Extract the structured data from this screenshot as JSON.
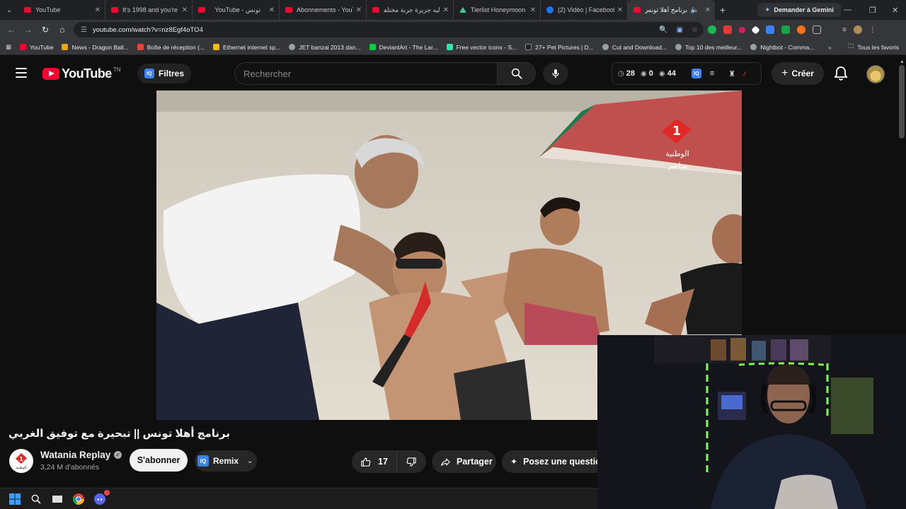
{
  "browser": {
    "tabs": [
      {
        "title": "YouTube",
        "icon": "youtube-favicon",
        "active": false
      },
      {
        "title": "It's 1998 and you're o",
        "icon": "youtube-favicon",
        "active": false
      },
      {
        "title": "YouTube - تونس",
        "icon": "youtube-favicon",
        "active": false
      },
      {
        "title": "Abonnements - YouT",
        "icon": "youtube-favicon",
        "active": false
      },
      {
        "title": "ليه جزيرة جربة مختلفة",
        "icon": "youtube-favicon",
        "active": false
      },
      {
        "title": "Tierlist Honeymoon d",
        "icon": "tierlist-favicon",
        "active": false
      },
      {
        "title": "(2) Vidéo | Facebook",
        "icon": "facebook-favicon",
        "active": false
      },
      {
        "title": "برنامج أهلا تونس ||",
        "icon": "youtube-favicon",
        "active": true
      }
    ],
    "gemini_label": "Demander à Gemini",
    "url": "youtube.com/watch?v=nz8Egf4oTO4",
    "bookmarks": [
      {
        "label": "YouTube",
        "color": "#ff0033"
      },
      {
        "label": "News - Dragon Ball...",
        "color": "#f4a300"
      },
      {
        "label": "Boîte de réception (...",
        "color": "#ea4335"
      },
      {
        "label": "Ethernet internet sp...",
        "color": "#fbbc04"
      },
      {
        "label": "JET banzai 2013 dan...",
        "color": "#9aa0a6"
      },
      {
        "label": "DeviantArt - The Lar...",
        "color": "#05cc47"
      },
      {
        "label": "Free vector icons - S...",
        "color": "#2ee6a8"
      },
      {
        "label": "27+ Pet Pictures | D...",
        "color": "#202124"
      },
      {
        "label": "Cut and Download...",
        "color": "#9aa0a6"
      },
      {
        "label": "Top 10 des meilleur...",
        "color": "#9aa0a6"
      },
      {
        "label": "Nightbot - Comma...",
        "color": "#9aa0a6"
      }
    ],
    "all_bookmarks_label": "Tous les favoris"
  },
  "youtube": {
    "logo_text": "YouTube",
    "country_code": "TN",
    "filtres_label": "Filtres",
    "search_placeholder": "Rechercher",
    "stats": {
      "watch_later": "28",
      "views": "0",
      "eye": "44"
    },
    "create_label": "Créer",
    "video": {
      "title": "برنامج أهلا تونس || تبحيرة مع توفيق الغربي",
      "channel_logo_text": "الوطنية",
      "channel_name": "Watania Replay",
      "subscribers": "3,24 M d'abonnés",
      "subscribe_label": "S'abonner",
      "remix_label": "Remix",
      "likes": "17",
      "share_label": "Partager",
      "ask_label": "Posez une question",
      "watermark_line1": "الوطنية",
      "watermark_line2": "مباشر"
    }
  }
}
